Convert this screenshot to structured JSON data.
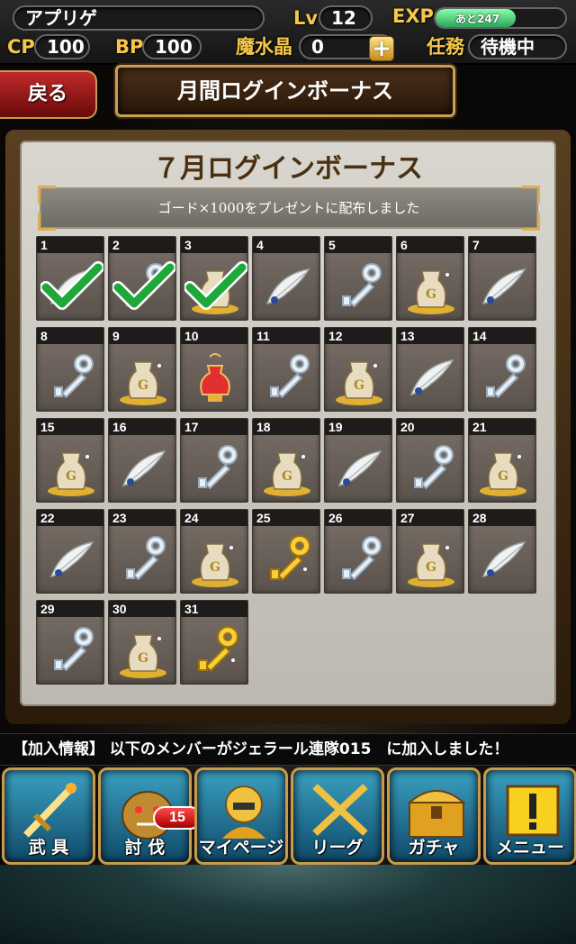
{
  "status": {
    "player_name": "アプリゲ",
    "lv_label": "Lv",
    "lv": "12",
    "exp_label": "EXP",
    "exp_text": "あと247",
    "exp_fraction": 0.62,
    "cp_label": "CP",
    "cp": "100",
    "bp_label": "BP",
    "bp": "100",
    "crystal_label": "魔水晶",
    "crystal": "0",
    "mission_label": "任務",
    "mission": "待機中"
  },
  "header": {
    "back": "戻る",
    "title": "月間ログインボーナス"
  },
  "panel": {
    "title": "７月ログインボーナス",
    "message": "ゴード×1000をプレゼントに配布しました"
  },
  "days": [
    {
      "day": "1",
      "item": "feather",
      "claimed": true
    },
    {
      "day": "2",
      "item": "key",
      "claimed": true
    },
    {
      "day": "3",
      "item": "gold",
      "claimed": true
    },
    {
      "day": "4",
      "item": "feather",
      "claimed": false
    },
    {
      "day": "5",
      "item": "key",
      "claimed": false
    },
    {
      "day": "6",
      "item": "gold",
      "claimed": false
    },
    {
      "day": "7",
      "item": "feather",
      "claimed": false
    },
    {
      "day": "8",
      "item": "key",
      "claimed": false
    },
    {
      "day": "9",
      "item": "gold",
      "claimed": false
    },
    {
      "day": "10",
      "item": "potion",
      "claimed": false
    },
    {
      "day": "11",
      "item": "key",
      "claimed": false
    },
    {
      "day": "12",
      "item": "gold",
      "claimed": false
    },
    {
      "day": "13",
      "item": "feather",
      "claimed": false
    },
    {
      "day": "14",
      "item": "key",
      "claimed": false
    },
    {
      "day": "15",
      "item": "gold",
      "claimed": false
    },
    {
      "day": "16",
      "item": "feather",
      "claimed": false
    },
    {
      "day": "17",
      "item": "key",
      "claimed": false
    },
    {
      "day": "18",
      "item": "gold",
      "claimed": false
    },
    {
      "day": "19",
      "item": "feather",
      "claimed": false
    },
    {
      "day": "20",
      "item": "key",
      "claimed": false
    },
    {
      "day": "21",
      "item": "gold",
      "claimed": false
    },
    {
      "day": "22",
      "item": "feather",
      "claimed": false
    },
    {
      "day": "23",
      "item": "key",
      "claimed": false
    },
    {
      "day": "24",
      "item": "gold",
      "claimed": false
    },
    {
      "day": "25",
      "item": "gold-key",
      "claimed": false
    },
    {
      "day": "26",
      "item": "key",
      "claimed": false
    },
    {
      "day": "27",
      "item": "gold",
      "claimed": false
    },
    {
      "day": "28",
      "item": "feather",
      "claimed": false
    },
    {
      "day": "29",
      "item": "key",
      "claimed": false
    },
    {
      "day": "30",
      "item": "gold",
      "claimed": false
    },
    {
      "day": "31",
      "item": "gold-key",
      "claimed": false
    }
  ],
  "ticker": "【加入情報】 以下のメンバーがジェラール連隊015　に加入しました！",
  "nav": [
    {
      "label": "武 具",
      "icon": "sword-icon"
    },
    {
      "label": "討 伐",
      "icon": "monster-icon",
      "badge": "15"
    },
    {
      "label": "マイページ",
      "icon": "knight-icon"
    },
    {
      "label": "リーグ",
      "icon": "crossed-swords-icon"
    },
    {
      "label": "ガチャ",
      "icon": "treasure-chest-icon"
    },
    {
      "label": "メニュー",
      "icon": "exclamation-icon"
    }
  ],
  "colors": {
    "accent": "#f5c84a",
    "frame": "#c99a4a",
    "claimed": "#1fa83a"
  }
}
